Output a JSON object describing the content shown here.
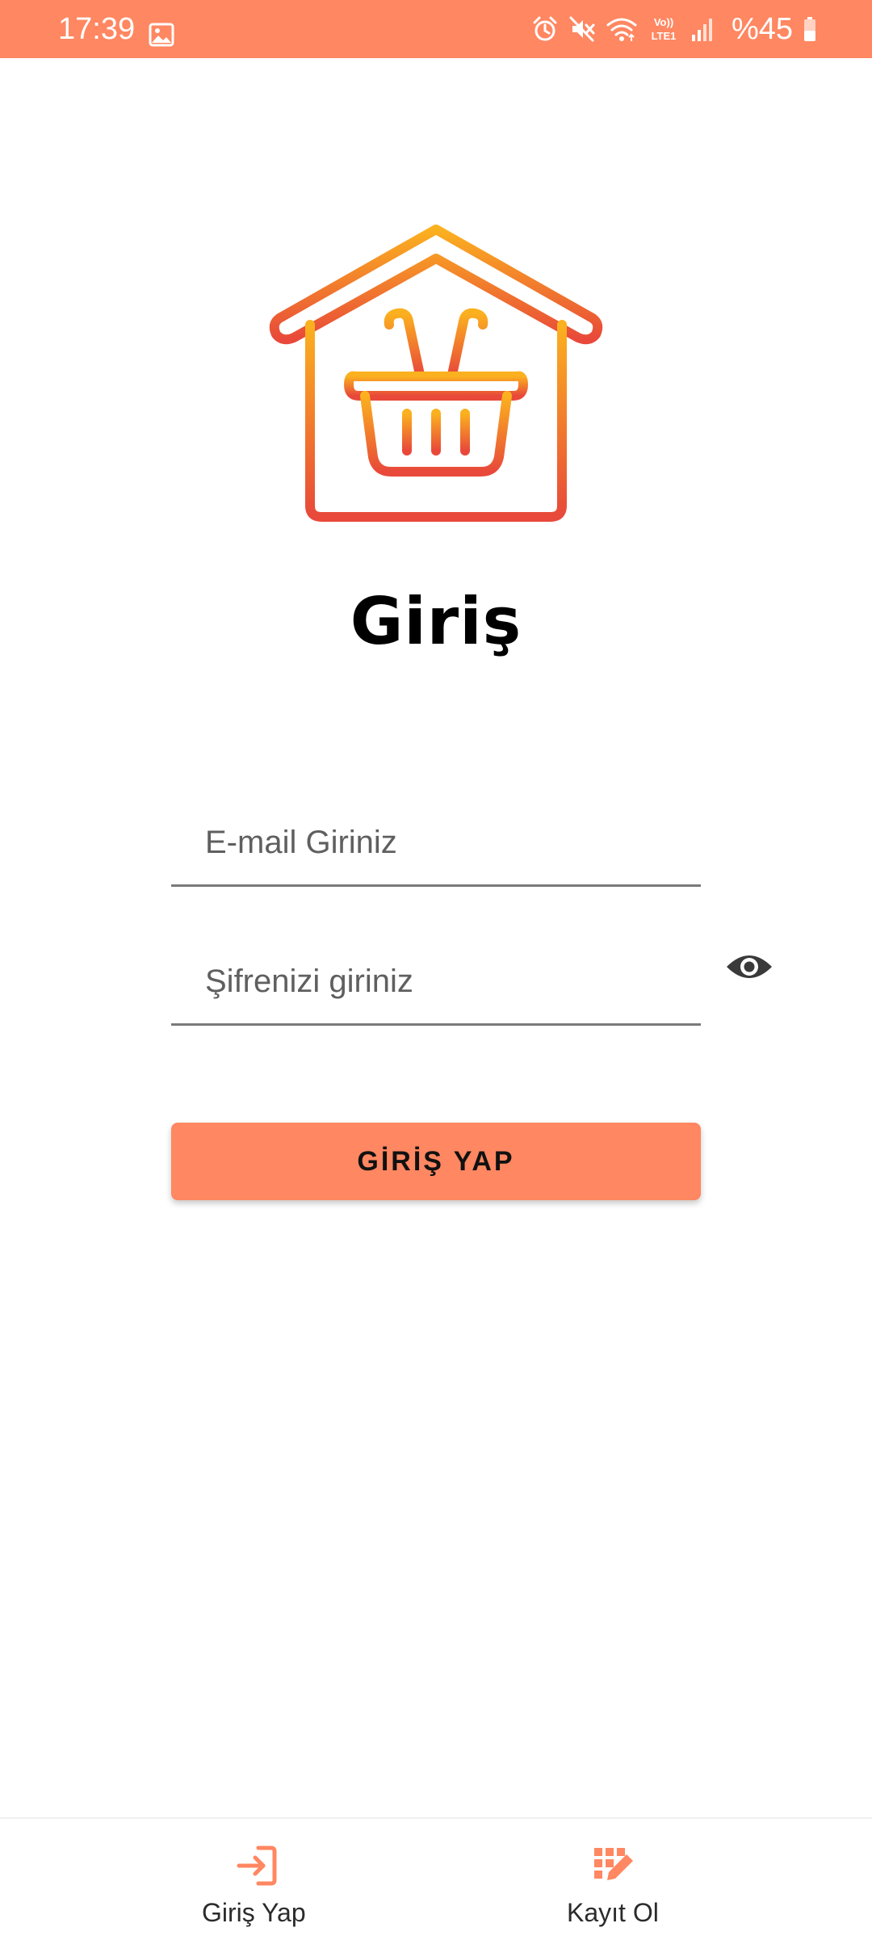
{
  "status_bar": {
    "time": "17:39",
    "battery": "%45",
    "network_label": "Vo)) LTE1",
    "icons": [
      "gallery-icon",
      "alarm-icon",
      "mute-icon",
      "wifi-icon",
      "lte-icon",
      "signal-icon",
      "battery-icon"
    ]
  },
  "logo": {
    "icon": "house-basket-logo"
  },
  "title": "Giriş",
  "form": {
    "email_placeholder": "E-mail Giriniz",
    "email_value": "",
    "password_placeholder": "Şifrenizi giriniz",
    "password_value": "",
    "visibility_icon": "eye-icon",
    "submit_label": "GİRİŞ YAP"
  },
  "bottom_nav": {
    "items": [
      {
        "label": "Giriş Yap",
        "icon": "login-icon"
      },
      {
        "label": "Kayıt Ol",
        "icon": "register-icon"
      }
    ]
  },
  "colors": {
    "accent": "#ff8761",
    "logo_gradient_top": "#fbb11f",
    "logo_gradient_bottom": "#e8493a",
    "text": "#000000"
  }
}
